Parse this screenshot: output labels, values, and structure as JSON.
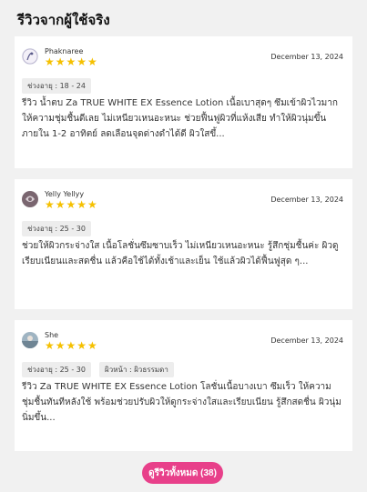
{
  "section": {
    "title": "รีวิวจากผู้ใช้จริง",
    "see_all_label": "ดูรีวิวทั้งหมด (38)"
  },
  "reviews": [
    {
      "name": "Phaknaree",
      "stars": "★★★★★",
      "rating": 5,
      "date": "December 13, 2024",
      "tags": [
        "ช่วงอายุ : 18 - 24"
      ],
      "text": "รีวิว น้ำตบ Za TRUE WHITE EX Essence Lotion เนื้อเบาสุดๆ ซึมเข้าผิวไวมาก ให้ความชุ่มชื้นดีเลย ไม่เหนียวเหนอะหนะ ช่วยฟื้นฟูผิวที่แห้งเสีย ทำให้ผิวนุ่มขึ้นภายใน 1-2 อาทิตย์ ลดเลือนจุดด่างดำได้ดี ผิวใสขึ้...",
      "avatar_icon": "user-avatar-icon"
    },
    {
      "name": "Yelly Yellyy",
      "stars": "★★★★★",
      "rating": 5,
      "date": "December 13, 2024",
      "tags": [
        "ช่วงอายุ : 25 - 30"
      ],
      "text": "ช่วยให้ผิวกระจ่างใส เนื้อโลชั่นซึมซาบเร็ว ไม่เหนียวเหนอะหนะ รู้สึกชุ่มชื้นค่ะ ผิวดูเรียบเนียนและสดชื่น แล้วคือใช้ได้ทั้งเช้าและเย็น ใช้แล้วผิวได้ฟื้นฟูสุด ๆ...",
      "avatar_icon": "user-avatar-icon"
    },
    {
      "name": "She",
      "stars": "★★★★★",
      "rating": 5,
      "date": "December 13, 2024",
      "tags": [
        "ช่วงอายุ : 25 - 30",
        "ผิวหน้า : ผิวธรรมดา"
      ],
      "text": "รีวิว Za TRUE WHITE EX Essence Lotion โลชั่นเนื้อบางเบา ซึมเร็ว ให้ความชุ่มชื้นทันทีหลังใช้ พร้อมช่วยปรับผิวให้ดูกระจ่างใสและเรียบเนียน รู้สึกสดชื่น ผิวนุ่มนิ่มขึ้น...",
      "avatar_icon": "user-avatar-icon"
    }
  ],
  "colors": {
    "background": "#f1f1f1",
    "card": "#ffffff",
    "star": "#f5c000",
    "button": "#e8408a",
    "tag": "#ededed"
  }
}
